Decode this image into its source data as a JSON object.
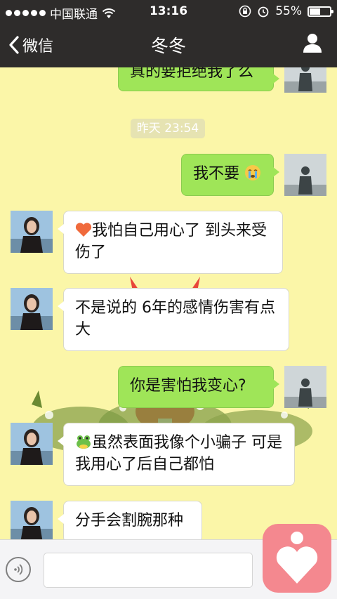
{
  "status_bar": {
    "carrier": "中国联通",
    "time": "13:16",
    "battery": "55%",
    "battery_level": 0.55
  },
  "nav": {
    "back_label": "微信",
    "title": "冬冬"
  },
  "chat": {
    "timestamp": "昨天 23:54",
    "messages": [
      {
        "side": "out",
        "text": "真的要拒绝我了么"
      },
      {
        "side": "out",
        "text": "我不要"
      },
      {
        "side": "in",
        "text": "我怕自己用心了  到头来受伤了"
      },
      {
        "side": "in",
        "text": "不是说的 6年的感情伤害有点大"
      },
      {
        "side": "out",
        "text": "你是害怕我变心?"
      },
      {
        "side": "in",
        "text": "虽然表面我像个小骗子 可是我用心了后自己都怕"
      },
      {
        "side": "in",
        "text": "分手会割腕那种"
      }
    ]
  },
  "colors": {
    "nav_bg": "#2e2c2b",
    "chat_bg": "#fbf6a8",
    "out_bubble": "#9fe558",
    "in_bubble": "#ffffff",
    "floating_app": "#f4888f"
  },
  "icons": [
    "signal-dots-icon",
    "wifi-icon",
    "lock-rotation-icon",
    "alarm-icon",
    "battery-icon",
    "back-chevron-icon",
    "user-icon",
    "crying-face-emoji-icon",
    "heart-emoji-icon",
    "frog-emoji-icon",
    "voice-icon",
    "heart-app-icon"
  ]
}
